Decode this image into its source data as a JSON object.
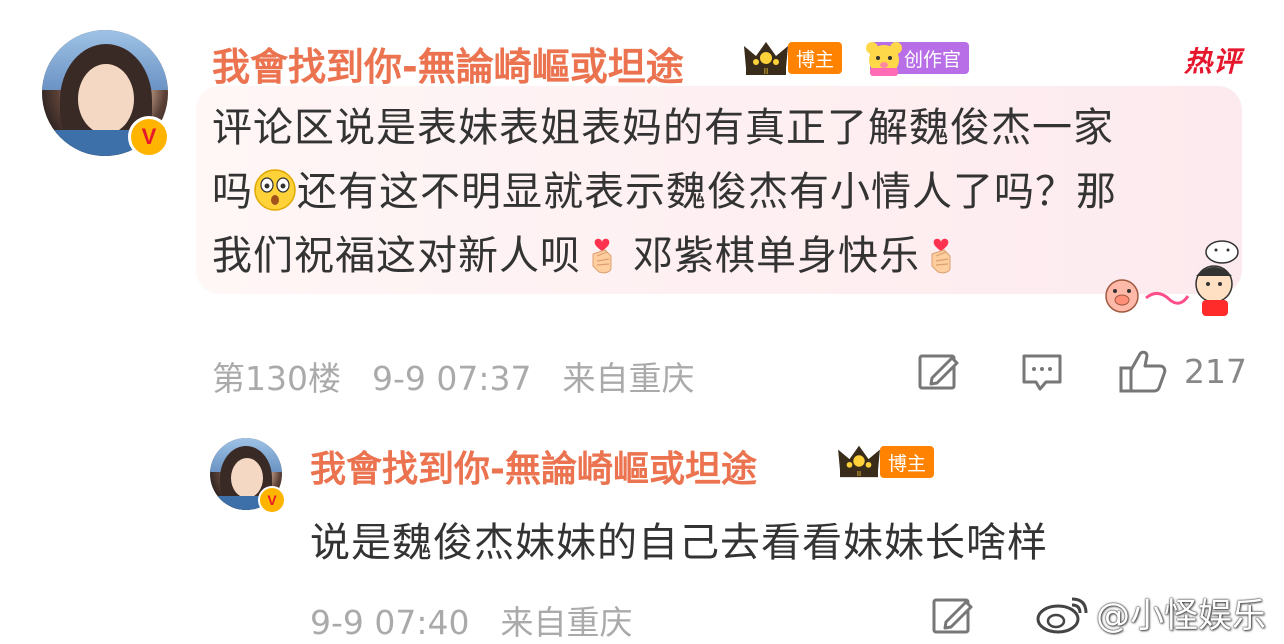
{
  "main_comment": {
    "username": "我會找到你-無論崎嶇或坦途",
    "tag_bozhu": "博主",
    "tag_creator": "创作官",
    "hot_label": "热评",
    "text_line1": "评论区说是表妹表姐表妈的有真正了解魏俊杰一家",
    "text_line2_a": "吗",
    "text_line2_b": "还有这不明显就表示魏俊杰有小情人了吗？那",
    "text_line3_a": "我们祝福这对新人呗",
    "text_line3_b": "邓紫棋单身快乐",
    "floor": "第130楼",
    "time": "9-9 07:37",
    "location": "来自重庆",
    "like_count": "217",
    "icons": [
      "edit-icon",
      "comment-icon",
      "like-icon"
    ]
  },
  "reply": {
    "username": "我會找到你-無論崎嶇或坦途",
    "tag_bozhu": "博主",
    "text": "说是魏俊杰妹妹的自己去看看妹妹长啥样",
    "time": "9-9 07:40",
    "location": "来自重庆"
  },
  "watermark": "@小怪娱乐",
  "colors": {
    "username": "#eb7350",
    "text": "#333333",
    "meta": "#aaaaaa",
    "hot": "#e6162d",
    "bozhu_tag": "#ff8200",
    "creator_tag": "#b86ee6",
    "bubble": "#fdeaee"
  }
}
